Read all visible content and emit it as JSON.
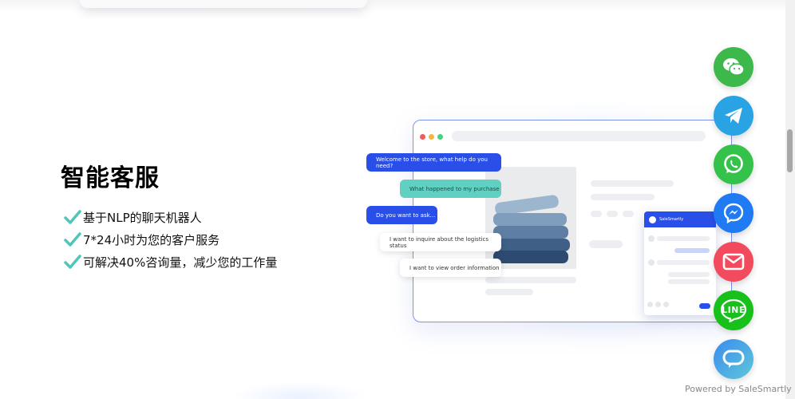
{
  "section": {
    "title": "智能客服",
    "features": [
      "基于NLP的聊天机器人",
      "7*24小时为您的客户服务",
      "可解决40%咨询量，减少您的工作量"
    ],
    "check_color": "#4fc6ba"
  },
  "illustration": {
    "bubbles": {
      "welcome": "Welcome to the store, what help do you need?",
      "purchase": "What happened to my purchase",
      "ask": "Do you want to ask...",
      "logistics": "I want to inquire about the logistics status",
      "order": "I want to view order information"
    },
    "widget_name": "SaleSmartly"
  },
  "social_buttons": [
    {
      "name": "wechat",
      "icon": "wechat-icon",
      "color": "#3cb94a"
    },
    {
      "name": "telegram",
      "icon": "telegram-icon",
      "color": "#29a3e4"
    },
    {
      "name": "whatsapp",
      "icon": "whatsapp-icon",
      "color": "#35c24b"
    },
    {
      "name": "messenger",
      "icon": "messenger-icon",
      "color": "#1f7af3"
    },
    {
      "name": "email",
      "icon": "mail-icon",
      "color": "#f24b5e"
    },
    {
      "name": "line",
      "icon": "line-icon",
      "color": "#18c01b",
      "label": "LINE"
    },
    {
      "name": "chat",
      "icon": "chat-bubble-icon",
      "color": "#3a8cf0"
    }
  ],
  "footer": {
    "powered_by": "Powered by SaleSmartly"
  }
}
